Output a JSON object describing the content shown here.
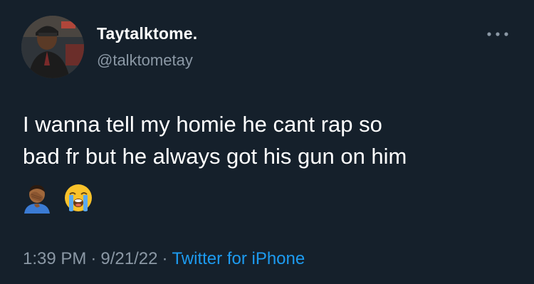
{
  "user": {
    "display_name": "Taytalktome.",
    "handle": "@talktometay",
    "avatar_icon": "profile-photo"
  },
  "menu": {
    "icon": "more-dots-icon"
  },
  "tweet": {
    "lines": [
      "I wanna tell my homie he cant rap so",
      "bad fr but he always got his gun on him"
    ],
    "emojis": [
      "🤦🏾‍♂️",
      "😭"
    ]
  },
  "meta": {
    "time": "1:39 PM",
    "separator": "·",
    "date": "9/21/22",
    "source": "Twitter for iPhone"
  },
  "colors": {
    "background": "#15202b",
    "primary_text": "#ffffff",
    "secondary_text": "#8b98a5",
    "link": "#1d9bf0"
  }
}
